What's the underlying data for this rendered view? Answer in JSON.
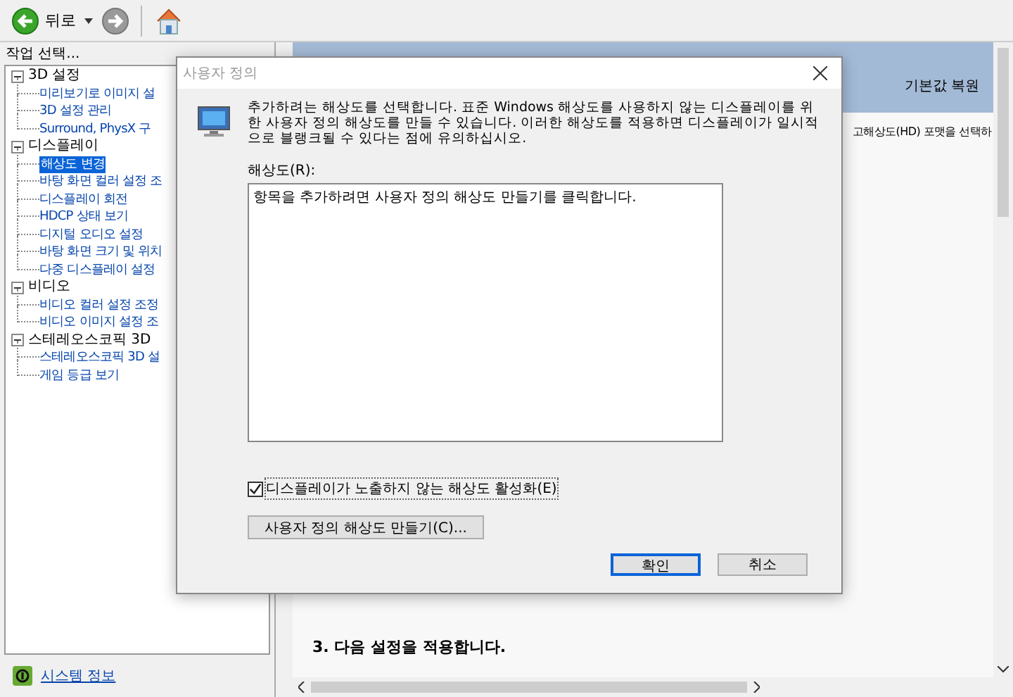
{
  "toolbar": {
    "back_label": "뒤로"
  },
  "sidebar": {
    "header": "작업 선택...",
    "tree": [
      {
        "label": "3D 설정",
        "expanded": true,
        "selected": false,
        "children": [
          {
            "label": "미리보기로 이미지 설",
            "selected": false
          },
          {
            "label": "3D 설정 관리",
            "selected": false
          },
          {
            "label": "Surround, PhysX 구",
            "selected": false
          }
        ]
      },
      {
        "label": "디스플레이",
        "expanded": true,
        "selected": false,
        "children": [
          {
            "label": "해상도 변경",
            "selected": true
          },
          {
            "label": "바탕 화면 컬러 설정 조",
            "selected": false
          },
          {
            "label": "디스플레이 회전",
            "selected": false
          },
          {
            "label": "HDCP 상태 보기",
            "selected": false
          },
          {
            "label": "디지털 오디오 설정",
            "selected": false
          },
          {
            "label": "바탕 화면 크기 및 위치",
            "selected": false
          },
          {
            "label": "다중 디스플레이 설정",
            "selected": false
          }
        ]
      },
      {
        "label": "비디오",
        "expanded": true,
        "selected": false,
        "children": [
          {
            "label": "비디오 컬러 설정 조정",
            "selected": false
          },
          {
            "label": "비디오 이미지 설정 조",
            "selected": false
          }
        ]
      },
      {
        "label": "스테레오스코픽 3D",
        "expanded": true,
        "selected": false,
        "children": [
          {
            "label": "스테레오스코픽 3D 설",
            "selected": false
          },
          {
            "label": "게임 등급 보기",
            "selected": false
          }
        ]
      }
    ],
    "footer_link": "시스템 정보"
  },
  "main": {
    "restore_link": "기본값 복원",
    "description_fragment": "고해상도(HD) 포맷을 선택하",
    "step_heading": "3. 다음 설정을 적용합니다."
  },
  "dialog": {
    "title": "사용자 정의",
    "description": "추가하려는 해상도를 선택합니다. 표준 Windows 해상도를 사용하지 않는 디스플레이를 위한 사용자 정의 해상도를 만들 수 있습니다. 이러한 해상도를 적용하면 디스플레이가 일시적으로 블랭크될 수 있다는 점에 유의하십시오.",
    "list_label": "해상도(R):",
    "list_text": "항목을 추가하려면 사용자 정의 해상도 만들기를 클릭합니다.",
    "checkbox": {
      "label": "디스플레이가 노출하지 않는 해상도 활성화(E)",
      "checked": true
    },
    "create_button": "사용자 정의 해상도 만들기(C)...",
    "buttons": [
      {
        "label": "확인",
        "default": true
      },
      {
        "label": "취소",
        "default": false
      }
    ]
  }
}
